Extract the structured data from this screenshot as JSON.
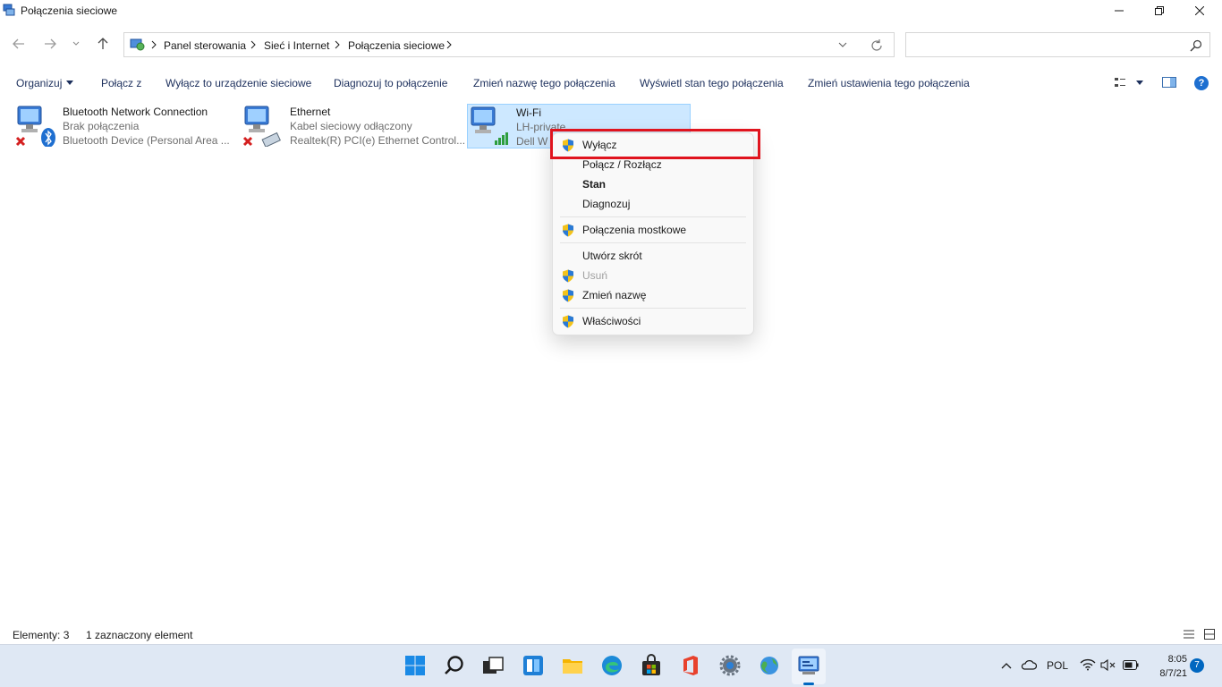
{
  "window": {
    "title": "Połączenia sieciowe"
  },
  "breadcrumb": [
    "Panel sterowania",
    "Sieć i Internet",
    "Połączenia sieciowe"
  ],
  "search": {
    "placeholder": ""
  },
  "commands": {
    "organize": "Organizuj",
    "connect_to": "Połącz z",
    "disable": "Wyłącz to urządzenie sieciowe",
    "diagnose": "Diagnozuj to połączenie",
    "rename": "Zmień nazwę tego połączenia",
    "view_status": "Wyświetl stan tego połączenia",
    "change_settings": "Zmień ustawienia tego połączenia"
  },
  "items": [
    {
      "name": "Bluetooth Network Connection",
      "status": "Brak połączenia",
      "device": "Bluetooth Device (Personal Area ..."
    },
    {
      "name": "Ethernet",
      "status": "Kabel sieciowy odłączony",
      "device": "Realtek(R) PCI(e) Ethernet Control..."
    },
    {
      "name": "Wi-Fi",
      "status": "LH-private",
      "device": "Dell W"
    }
  ],
  "context_menu": [
    {
      "label": "Wyłącz",
      "shield": true
    },
    {
      "label": "Połącz / Rozłącz",
      "shield": false
    },
    {
      "label": "Stan",
      "shield": false,
      "bold": true
    },
    {
      "label": "Diagnozuj",
      "shield": false
    },
    {
      "label": "Połączenia mostkowe",
      "shield": true
    },
    {
      "label": "Utwórz skrót",
      "shield": false
    },
    {
      "label": "Usuń",
      "shield": true,
      "disabled": true
    },
    {
      "label": "Zmień nazwę",
      "shield": true
    },
    {
      "label": "Właściwości",
      "shield": true
    }
  ],
  "status_bar": {
    "count": "Elementy: 3",
    "selected": "1 zaznaczony element"
  },
  "taskbar": {
    "icons": [
      "windows-start-icon",
      "search-icon",
      "task-view-icon",
      "widgets-icon",
      "file-explorer-icon",
      "edge-icon",
      "store-icon",
      "office-icon",
      "settings-icon",
      "network-globe-icon",
      "control-panel-icon"
    ],
    "language": "POL",
    "time": "8:05",
    "date": "8/7/21",
    "notifications": "7"
  },
  "colors": {
    "accent": "#0067c0",
    "selection": "#cde8ff",
    "highlight_box": "#e0141e",
    "taskbar": "#dfe8f4"
  }
}
